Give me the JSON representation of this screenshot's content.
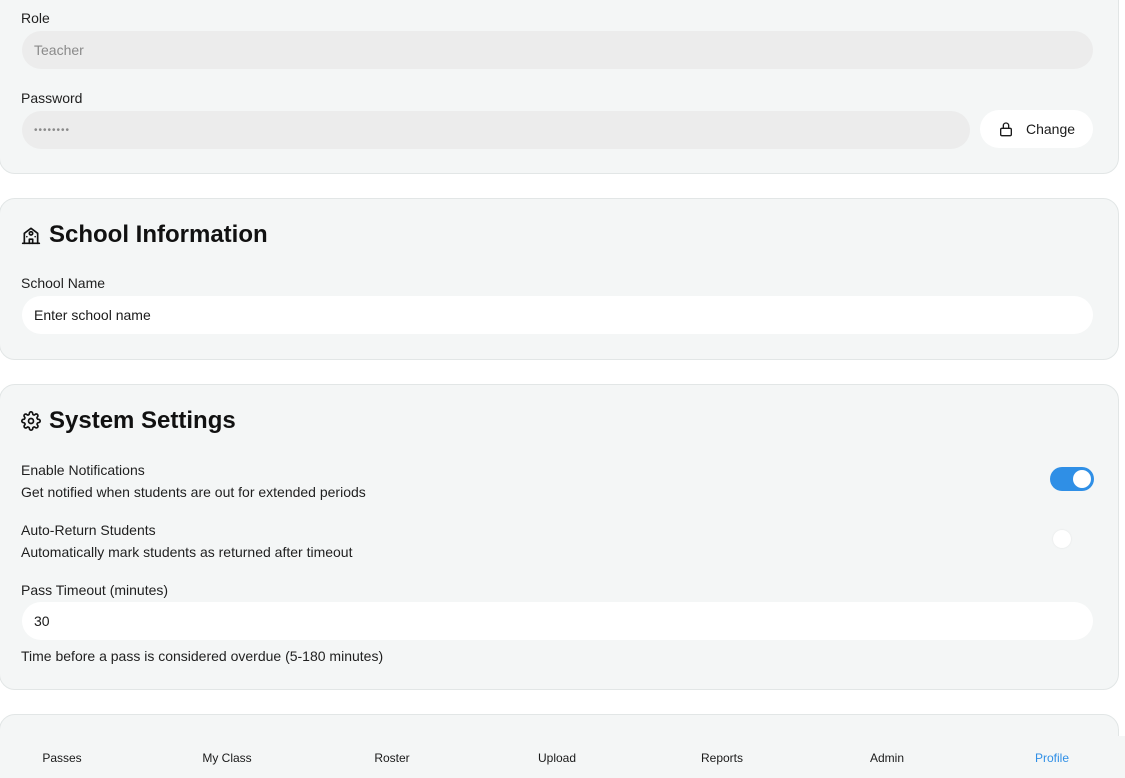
{
  "account": {
    "role_label": "Role",
    "role_value": "Teacher",
    "password_label": "Password",
    "password_value": "••••••••",
    "change_button": "Change",
    "lock_icon": "lock-icon"
  },
  "school": {
    "title": "School Information",
    "icon": "school-icon",
    "name_label": "School Name",
    "name_placeholder": "Enter school name"
  },
  "system": {
    "title": "System Settings",
    "icon": "gear-icon",
    "notifications_title": "Enable Notifications",
    "notifications_desc": "Get notified when students are out for extended periods",
    "notifications_enabled": true,
    "auto_return_title": "Auto-Return Students",
    "auto_return_desc": "Automatically mark students as returned after timeout",
    "auto_return_enabled": false,
    "timeout_label": "Pass Timeout (minutes)",
    "timeout_value": "30",
    "timeout_help": "Time before a pass is considered overdue (5-180 minutes)"
  },
  "nav": {
    "items": [
      "Passes",
      "My Class",
      "Roster",
      "Upload",
      "Reports",
      "Admin",
      "Profile"
    ],
    "active": "Profile"
  },
  "colors": {
    "accent": "#2f8fe6",
    "card_background": "#f4f6f6",
    "input_disabled": "#ececec"
  }
}
